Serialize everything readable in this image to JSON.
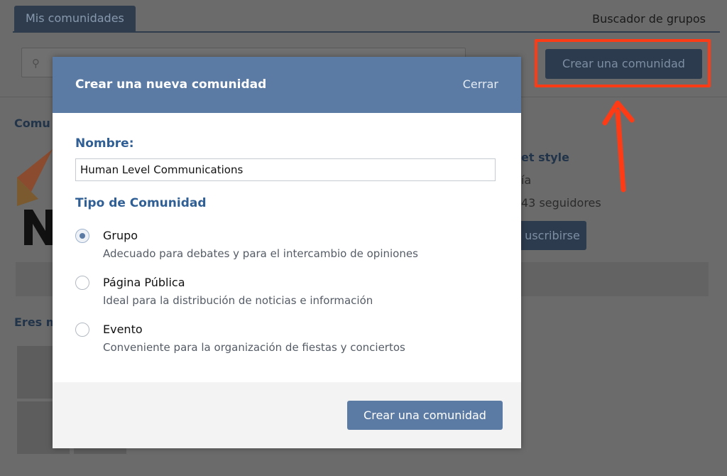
{
  "background": {
    "tab_active": "Mis comunidades",
    "tab_search": "Buscador de grupos",
    "create_button": "Crear una comunidad",
    "heading_1": "Comu",
    "heading_2": "Eres m",
    "group_name_fragment": "et style",
    "group_type_fragment": "ía",
    "followers_fragment": "43 seguidores",
    "subscribe_fragment": "uscribirse"
  },
  "modal": {
    "title": "Crear una nueva comunidad",
    "close_label": "Cerrar",
    "name_label": "Nombre:",
    "name_value": "Human Level Communications",
    "type_label": "Tipo de Comunidad",
    "options": [
      {
        "label": "Grupo",
        "description": "Adecuado para debates y para el intercambio de opiniones",
        "checked": true
      },
      {
        "label": "Página Pública",
        "description": "Ideal para la distribución de noticias e información",
        "checked": false
      },
      {
        "label": "Evento",
        "description": "Conveniente para la organización de fiestas y conciertos",
        "checked": false
      }
    ],
    "submit_label": "Crear una comunidad"
  },
  "colors": {
    "header_blue": "#5b7ba4",
    "label_blue": "#2f5f95",
    "highlight_red": "#ff3b16",
    "overlay_gray": "#6b6b6b"
  }
}
